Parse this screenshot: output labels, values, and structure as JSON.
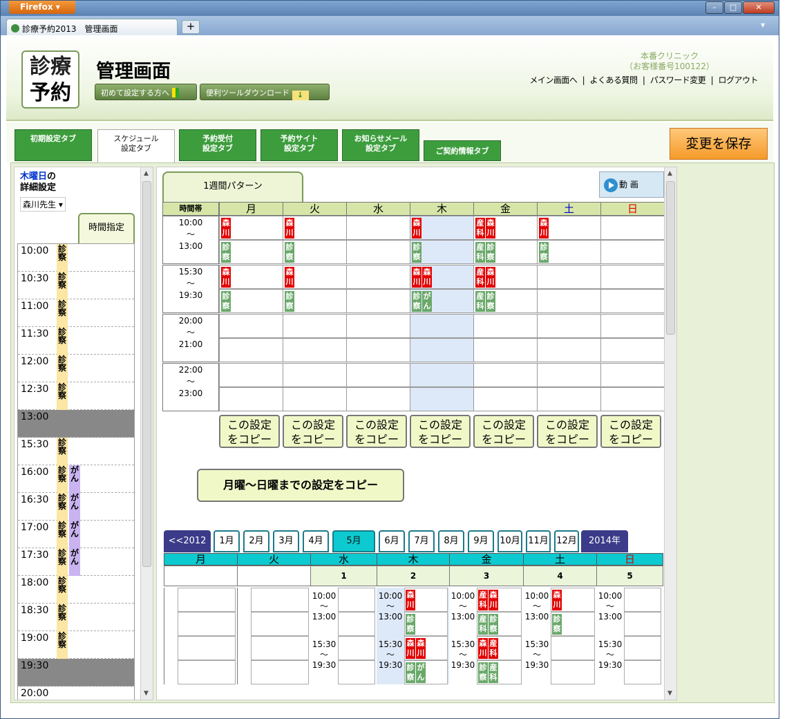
{
  "browser": {
    "menu_label": "Firefox",
    "tab_title": "診療予約2013　管理画面",
    "new_tab": "+",
    "win_min": "–",
    "win_max": "□",
    "win_close": "✕",
    "tab_menu": "▾"
  },
  "header": {
    "logo_line1": "診療",
    "logo_line2": "予約",
    "title": "管理画面",
    "btn_first": "初めて設定する方へ",
    "btn_tools": "便利ツールダウンロード",
    "clinic_name": "本番クリニック",
    "customer_no": "（お客様番号100122）",
    "links": [
      "メイン画面へ",
      "よくある質問",
      "パスワード変更",
      "ログアウト"
    ],
    "separator": "|"
  },
  "tabs": [
    {
      "label1": "初期設定タブ",
      "label2": ""
    },
    {
      "label1": "スケジュール",
      "label2": "設定タブ"
    },
    {
      "label1": "予約受付",
      "label2": "設定タブ"
    },
    {
      "label1": "予約サイト",
      "label2": "設定タブ"
    },
    {
      "label1": "お知らせメール",
      "label2": "設定タブ"
    },
    {
      "label1": "ご契約情報タブ",
      "label2": ""
    }
  ],
  "save_button": "変更を保存",
  "left": {
    "day": "木曜日",
    "suffix": "の",
    "subtitle": "詳細設定",
    "doctor": "森川先生",
    "time_tab": "時間指定",
    "slots": [
      {
        "time": "10:00",
        "gray": false,
        "marks": [
          "診察"
        ]
      },
      {
        "time": "10:30",
        "gray": false,
        "marks": [
          "診察"
        ]
      },
      {
        "time": "11:00",
        "gray": false,
        "marks": [
          "診察"
        ]
      },
      {
        "time": "11:30",
        "gray": false,
        "marks": [
          "診察"
        ]
      },
      {
        "time": "12:00",
        "gray": false,
        "marks": [
          "診察"
        ]
      },
      {
        "time": "12:30",
        "gray": false,
        "marks": [
          "診察"
        ]
      },
      {
        "time": "13:00",
        "gray": true,
        "marks": []
      },
      {
        "time": "15:30",
        "gray": false,
        "marks": [
          "診察"
        ]
      },
      {
        "time": "16:00",
        "gray": false,
        "marks": [
          "診察",
          "がん"
        ]
      },
      {
        "time": "16:30",
        "gray": false,
        "marks": [
          "診察",
          "がん"
        ]
      },
      {
        "time": "17:00",
        "gray": false,
        "marks": [
          "診察",
          "がん"
        ]
      },
      {
        "time": "17:30",
        "gray": false,
        "marks": [
          "診察",
          "がん"
        ]
      },
      {
        "time": "18:00",
        "gray": false,
        "marks": [
          "診察"
        ]
      },
      {
        "time": "18:30",
        "gray": false,
        "marks": [
          "診察"
        ]
      },
      {
        "time": "19:00",
        "gray": false,
        "marks": [
          "診察"
        ]
      },
      {
        "time": "19:30",
        "gray": true,
        "marks": []
      },
      {
        "time": "20:00",
        "gray": false,
        "marks": []
      }
    ]
  },
  "week": {
    "tab_label": "1週間パターン",
    "video_label": "動 画",
    "time_header": "時間帯",
    "days": [
      {
        "label": "月",
        "color": "#000000"
      },
      {
        "label": "火",
        "color": "#000000"
      },
      {
        "label": "水",
        "color": "#000000"
      },
      {
        "label": "木",
        "color": "#000000"
      },
      {
        "label": "金",
        "color": "#000000"
      },
      {
        "label": "土",
        "color": "#0000cc"
      },
      {
        "label": "日",
        "color": "#e00000"
      }
    ],
    "periods": [
      {
        "start": "10:00",
        "tilde": "〜",
        "end": "13:00",
        "docs": [
          [
            "森川"
          ],
          [
            "森川"
          ],
          [],
          [
            "森川"
          ],
          [
            "産科",
            "森川"
          ],
          [
            "森川"
          ],
          []
        ],
        "types": [
          [
            "診察"
          ],
          [
            "診察"
          ],
          [],
          [
            "診察"
          ],
          [
            "産科",
            "診察"
          ],
          [
            "診察"
          ],
          []
        ]
      },
      {
        "start": "15:30",
        "tilde": "〜",
        "end": "19:30",
        "docs": [
          [
            "森川"
          ],
          [
            "森川"
          ],
          [],
          [
            "森川",
            "森川"
          ],
          [
            "産科",
            "森川"
          ],
          [],
          []
        ],
        "types": [
          [
            "診察"
          ],
          [
            "診察"
          ],
          [],
          [
            "診察",
            "がん"
          ],
          [
            "産科",
            "診察"
          ],
          [],
          []
        ]
      },
      {
        "start": "20:00",
        "tilde": "〜",
        "end": "21:00",
        "docs": [
          [],
          [],
          [],
          [],
          [],
          [],
          []
        ],
        "types": [
          [],
          [],
          [],
          [],
          [],
          [],
          []
        ]
      },
      {
        "start": "22:00",
        "tilde": "〜",
        "end": "23:00",
        "docs": [
          [],
          [],
          [],
          [],
          [],
          [],
          []
        ],
        "types": [
          [],
          [],
          [],
          [],
          [],
          [],
          []
        ]
      }
    ],
    "copy_l1": "この設定",
    "copy_l2": "をコピー",
    "copy_all": "月曜〜日曜までの設定をコピー"
  },
  "month": {
    "prev": "<<2012年",
    "next": "2014年>>",
    "months": [
      "1月",
      "2月",
      "3月",
      "4月",
      "5月",
      "6月",
      "7月",
      "8月",
      "9月",
      "10月",
      "11月",
      "12月"
    ],
    "selected": "5月",
    "days": [
      {
        "label": "月",
        "color": "#000000"
      },
      {
        "label": "火",
        "color": "#000000"
      },
      {
        "label": "水",
        "color": "#000000"
      },
      {
        "label": "木",
        "color": "#000000"
      },
      {
        "label": "金",
        "color": "#000000"
      },
      {
        "label": "土",
        "color": "#000000"
      },
      {
        "label": "日",
        "color": "#e00000"
      }
    ],
    "dates": [
      "",
      "",
      "1",
      "2",
      "3",
      "4",
      "5"
    ],
    "rows": [
      {
        "start": "10:00",
        "tilde": "〜",
        "end": "13:00",
        "docs": [
          [],
          [],
          [],
          [
            "森川"
          ],
          [
            "産科",
            "森川"
          ],
          [
            "森川"
          ],
          []
        ],
        "types": [
          [],
          [],
          [],
          [
            "診察"
          ],
          [
            "産科",
            "診察"
          ],
          [
            "診察"
          ],
          []
        ]
      },
      {
        "start": "15:30",
        "tilde": "〜",
        "end": "19:30",
        "docs": [
          [],
          [],
          [],
          [
            "森川",
            "森川"
          ],
          [
            "森川",
            "産科"
          ],
          [],
          []
        ],
        "types": [
          [],
          [],
          [],
          [
            "診察",
            "がん"
          ],
          [
            "診察",
            "産科"
          ],
          [],
          []
        ]
      }
    ]
  }
}
